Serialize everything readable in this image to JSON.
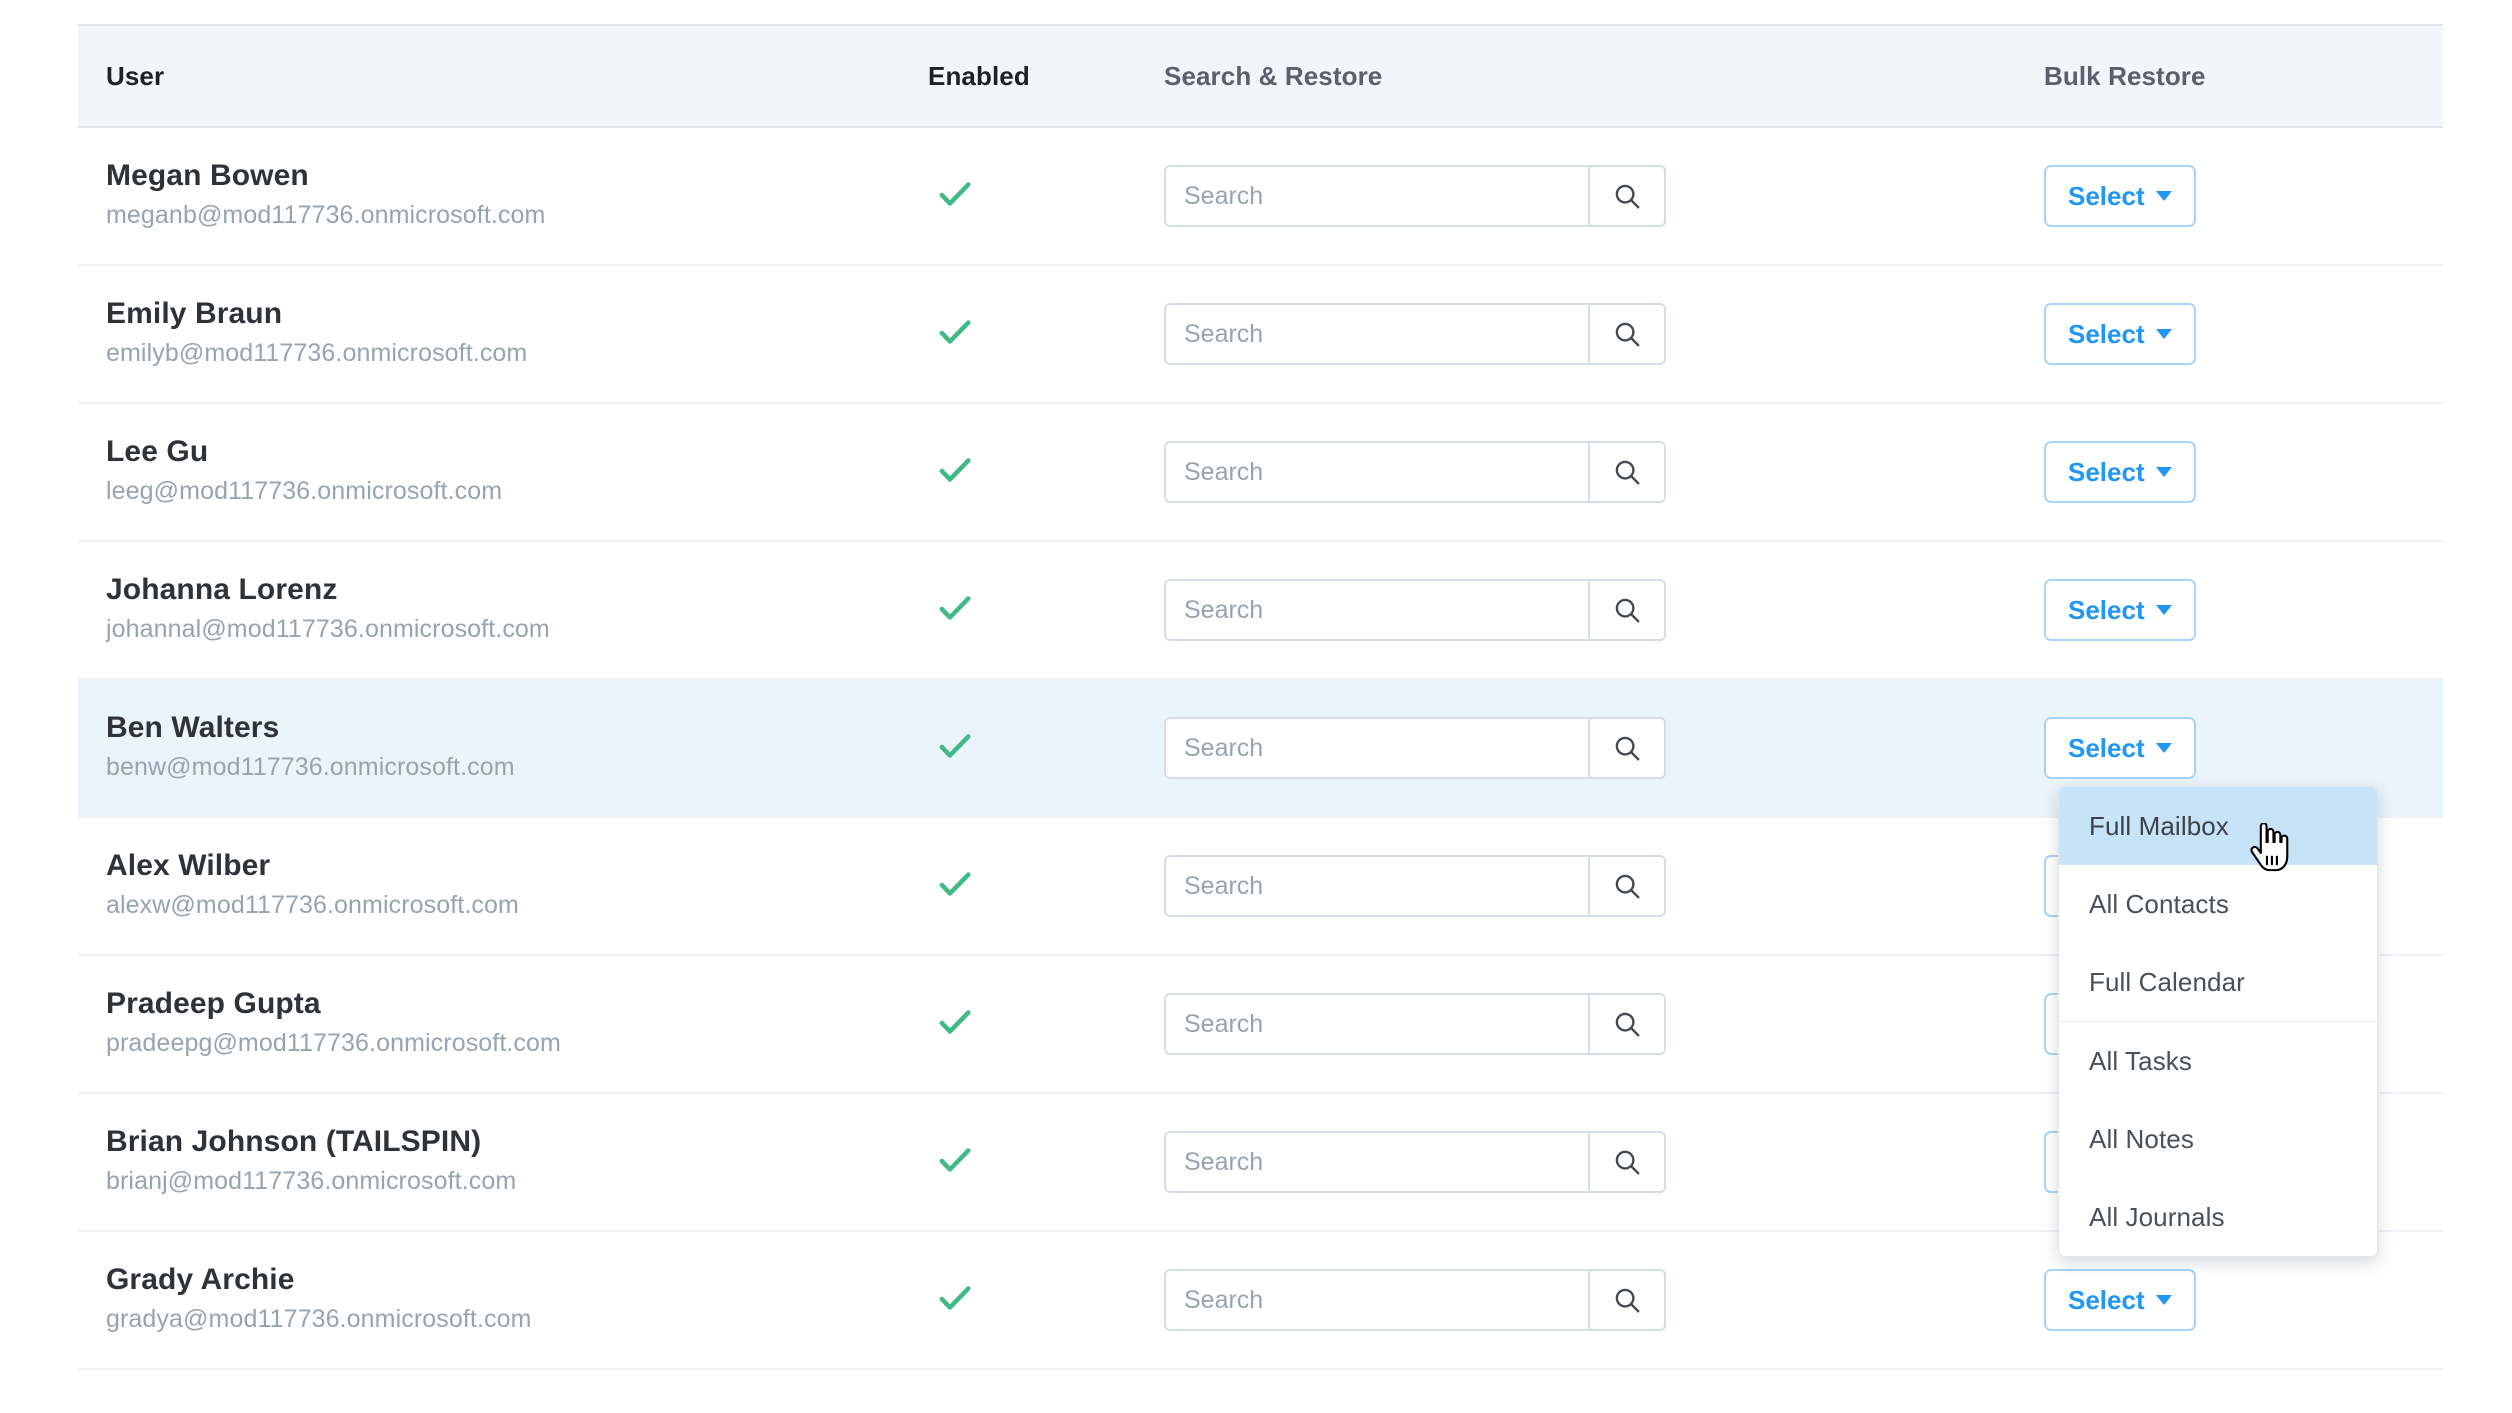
{
  "table": {
    "columns": [
      {
        "key": "user",
        "label": "User"
      },
      {
        "key": "enabled",
        "label": "Enabled"
      },
      {
        "key": "search",
        "label": "Search & Restore"
      },
      {
        "key": "bulk",
        "label": "Bulk Restore"
      }
    ],
    "search_placeholder": "Search",
    "search_value": "",
    "select_label": "Select",
    "enabled_icon": "check-icon",
    "search_icon": "magnifier-icon",
    "caret_icon": "caret-down-icon",
    "rows": [
      {
        "name": "Megan Bowen",
        "email": "meganb@mod117736.onmicrosoft.com",
        "enabled": true,
        "highlighted": false
      },
      {
        "name": "Emily Braun",
        "email": "emilyb@mod117736.onmicrosoft.com",
        "enabled": true,
        "highlighted": false
      },
      {
        "name": "Lee Gu",
        "email": "leeg@mod117736.onmicrosoft.com",
        "enabled": true,
        "highlighted": false
      },
      {
        "name": "Johanna Lorenz",
        "email": "johannal@mod117736.onmicrosoft.com",
        "enabled": true,
        "highlighted": false
      },
      {
        "name": "Ben Walters",
        "email": "benw@mod117736.onmicrosoft.com",
        "enabled": true,
        "highlighted": true
      },
      {
        "name": "Alex Wilber",
        "email": "alexw@mod117736.onmicrosoft.com",
        "enabled": true,
        "highlighted": false
      },
      {
        "name": "Pradeep Gupta",
        "email": "pradeepg@mod117736.onmicrosoft.com",
        "enabled": true,
        "highlighted": false
      },
      {
        "name": "Brian Johnson (TAILSPIN)",
        "email": "brianj@mod117736.onmicrosoft.com",
        "enabled": true,
        "highlighted": false
      },
      {
        "name": "Grady Archie",
        "email": "gradya@mod117736.onmicrosoft.com",
        "enabled": true,
        "highlighted": false
      }
    ]
  },
  "dropdown": {
    "open_for_row": 4,
    "items": [
      {
        "label": "Full Mailbox",
        "active": true,
        "separator_after": false
      },
      {
        "label": "All Contacts",
        "active": false,
        "separator_after": false
      },
      {
        "label": "Full Calendar",
        "active": false,
        "separator_after": true
      },
      {
        "label": "All Tasks",
        "active": false,
        "separator_after": false
      },
      {
        "label": "All Notes",
        "active": false,
        "separator_after": false
      },
      {
        "label": "All Journals",
        "active": false,
        "separator_after": false
      }
    ]
  },
  "cursor": {
    "icon": "hand-pointer-cursor"
  },
  "colors": {
    "header_bg": "#f2f5f9",
    "row_highlight": "#e9f4fb",
    "check_green": "#3fba85",
    "accent_blue": "#2196f3",
    "select_border": "#a9d4f5",
    "dropdown_active": "#c7e3f8"
  }
}
